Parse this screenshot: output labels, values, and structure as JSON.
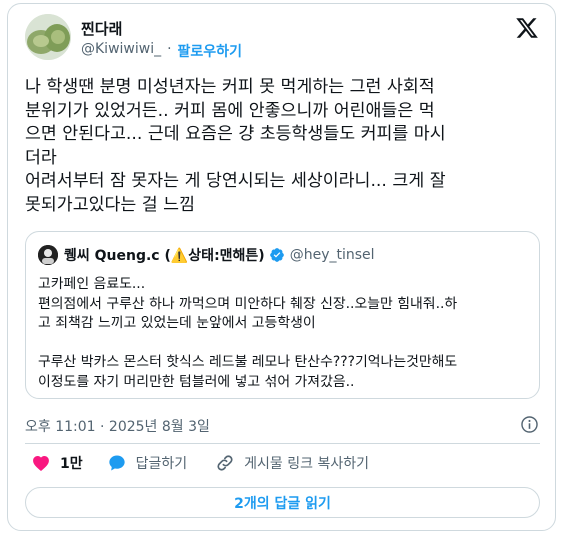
{
  "author": {
    "display_name": "찐다래",
    "handle": "@Kiwiwiwi_",
    "separator": "·",
    "follow_label": "팔로우하기"
  },
  "tweet": {
    "lines": [
      "나 학생땐  분명 미성년자는 커피 못 먹게하는 그런 사회적",
      "분위기가 있었거든.. 커피 몸에 안좋으니까 어린애들은 먹",
      "으면 안된다고... 근데 요즘은 걍 초등학생들도 커피를 마시",
      "더라",
      "어려서부터 잠 못자는 게 당연시되는 세상이라니... 크게 잘",
      "못되가고있다는 걸 느낌"
    ]
  },
  "quote": {
    "name": "퀭씨 Queng.c (⚠️상태:맨해튼)",
    "handle": "@hey_tinsel",
    "lines": [
      "고카페인 음료도...",
      "편의점에서 구루산 하나 까먹으며 미안하다 췌장 신장..오늘만 힘내줘..하",
      "고 죄책감 느끼고 있었는데 눈앞에서 고등학생이",
      "",
      "구루산 박카스 몬스터 핫식스 레드불 레모나 탄산수???기억나는것만해도",
      "이정도를 자기 머리만한 텀블러에 넣고 섞어 가져갔음.."
    ]
  },
  "timestamp": "오후 11:01 · 2025년 8월 3일",
  "actions": {
    "like_count": "1만",
    "reply_label": "답글하기",
    "copy_link_label": "게시물 링크 복사하기"
  },
  "read_replies_label": "2개의 답글 읽기",
  "colors": {
    "accent": "#1d9bf0",
    "like": "#f91880",
    "text": "#0f1419",
    "secondary": "#536471",
    "border": "#cfd9de"
  },
  "icons": {
    "logo": "x-logo-icon",
    "verified": "verified-badge-icon",
    "warning": "warning-icon",
    "info": "info-icon",
    "like": "heart-icon",
    "reply": "speech-bubble-icon",
    "copy_link": "link-icon"
  }
}
